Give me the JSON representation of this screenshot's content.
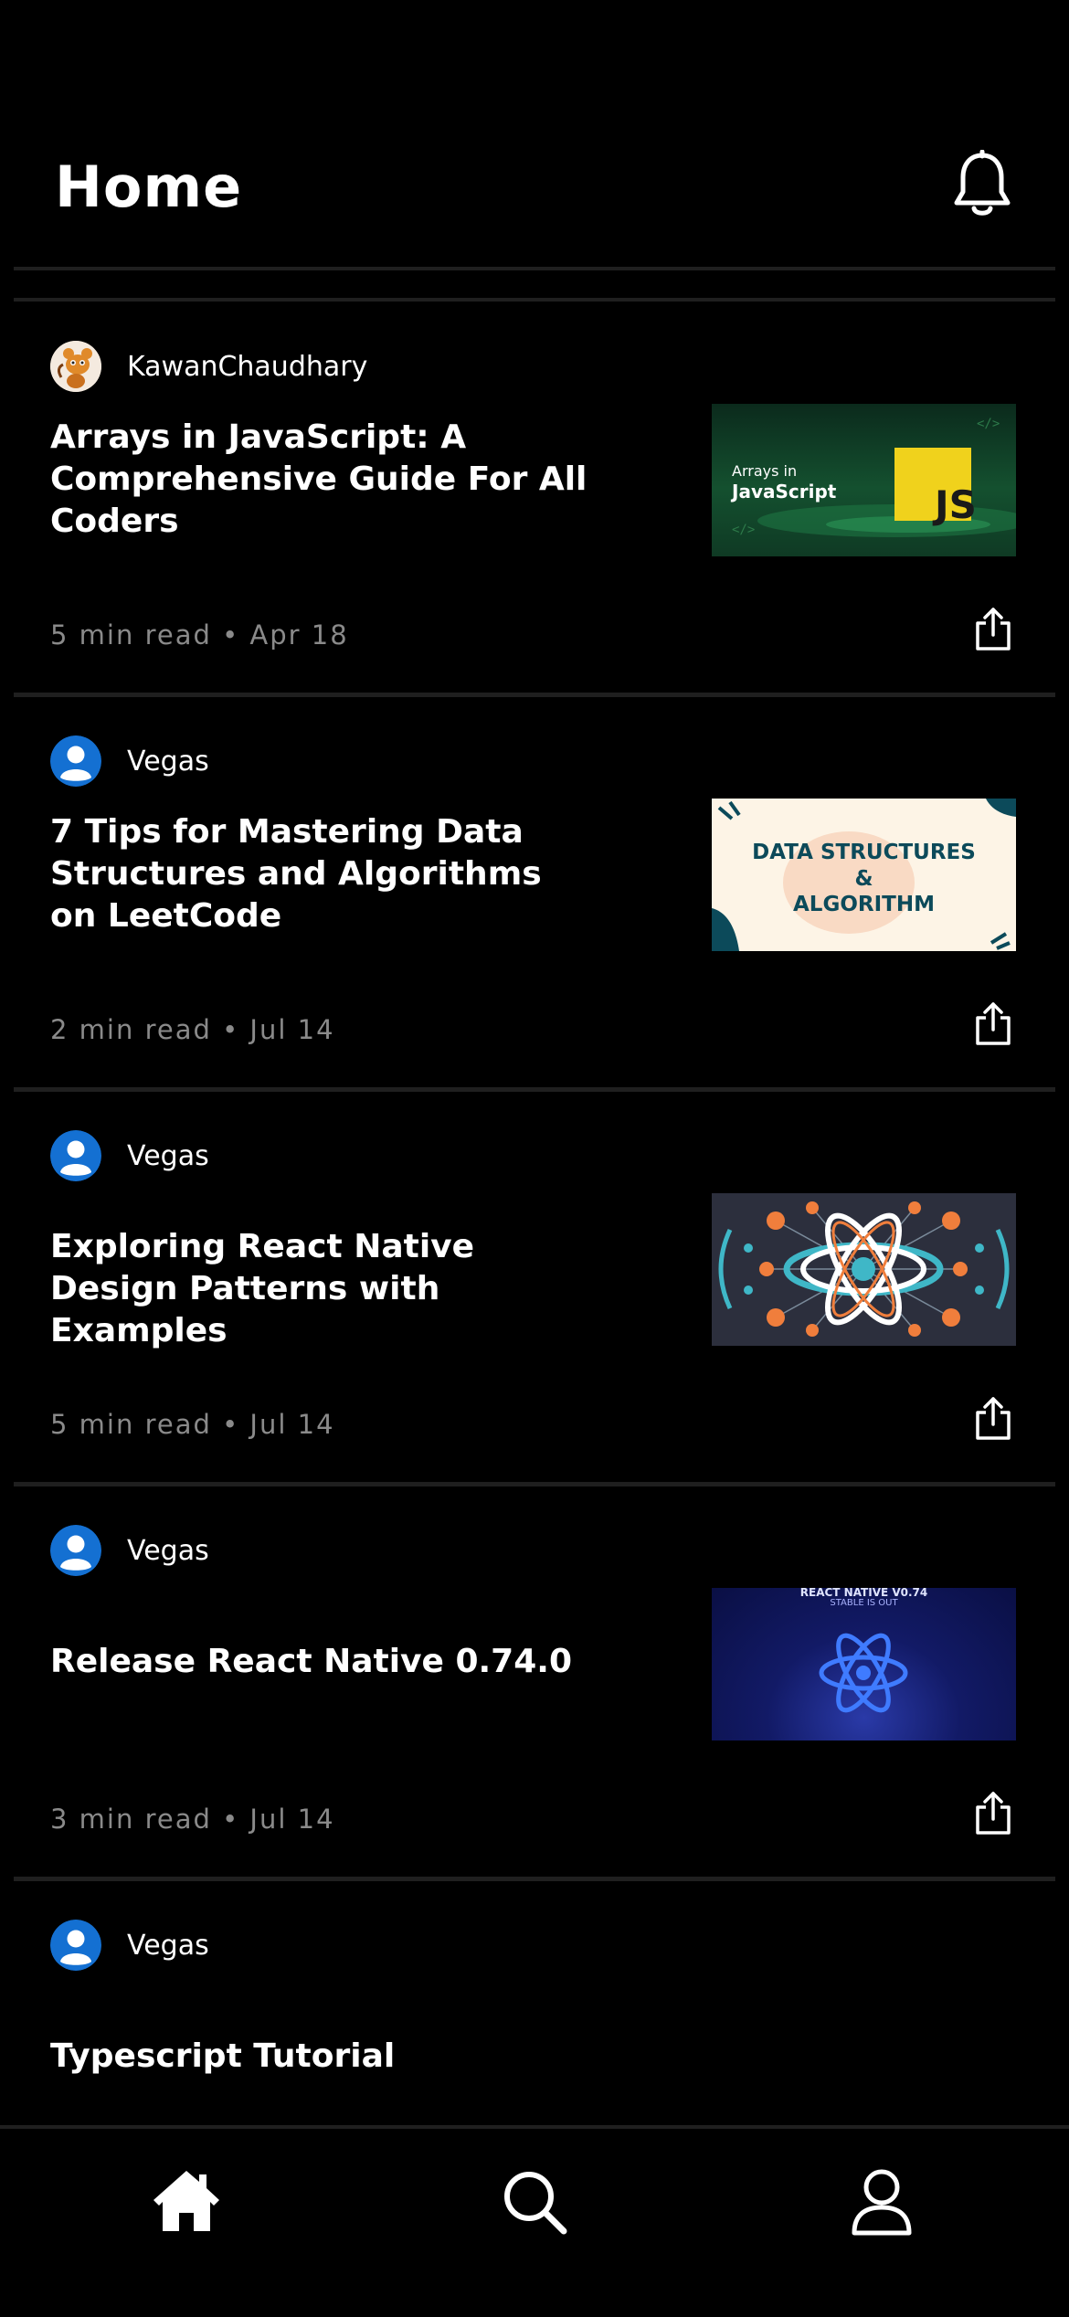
{
  "header": {
    "title": "Home",
    "notification_icon": "bell-icon"
  },
  "articles": [
    {
      "author": "KawanChaudhary",
      "avatar": "cartoon-avatar",
      "title": "Arrays in JavaScript: A Comprehensive Guide For All Coders",
      "meta": "5 min read • Apr 18",
      "thumbnail": {
        "line1": "Arrays in",
        "line2": "JavaScript",
        "badge": "JS"
      }
    },
    {
      "author": "Vegas",
      "avatar": "user-avatar",
      "title": "7 Tips for Mastering Data Structures and Algorithms on LeetCode",
      "meta": "2 min read • Jul 14",
      "thumbnail": {
        "line1": "DATA STRUCTURES",
        "line2": "&",
        "line3": "ALGORITHM"
      }
    },
    {
      "author": "Vegas",
      "avatar": "user-avatar",
      "title": "Exploring React Native Design Patterns with Examples",
      "meta": "5 min read • Jul 14",
      "thumbnail": {
        "image": "react-atom-network"
      }
    },
    {
      "author": "Vegas",
      "avatar": "user-avatar",
      "title": "Release React Native 0.74.0",
      "meta": "3 min read • Jul 14",
      "thumbnail": {
        "line1": "REACT NATIVE V0.74",
        "line2": "STABLE IS OUT"
      }
    },
    {
      "author": "Vegas",
      "avatar": "user-avatar",
      "title": "Typescript Tutorial"
    }
  ],
  "tabs": [
    {
      "name": "home",
      "icon": "home-icon",
      "active": true
    },
    {
      "name": "search",
      "icon": "search-icon",
      "active": false
    },
    {
      "name": "profile",
      "icon": "profile-icon",
      "active": false
    }
  ],
  "colors": {
    "background": "#000000",
    "divider": "#1f1f1f",
    "meta_text": "#8a8a8a",
    "avatar_blue": "#1470d2"
  }
}
